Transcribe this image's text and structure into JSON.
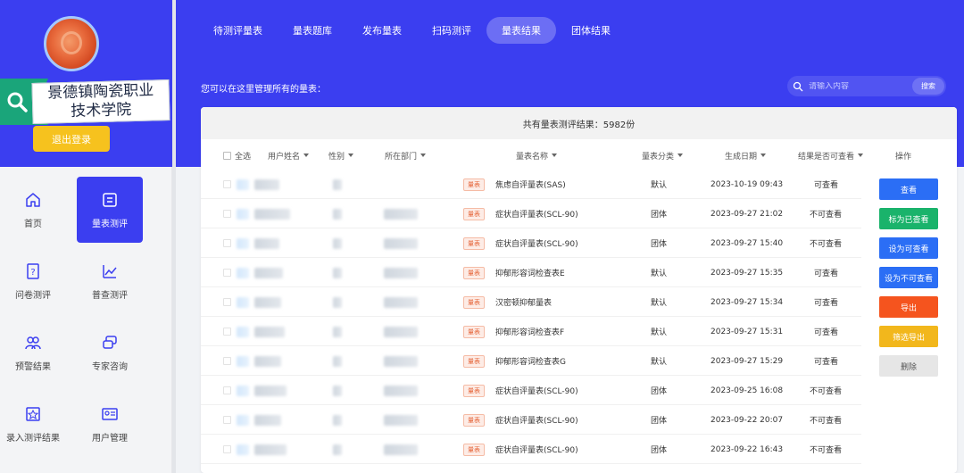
{
  "sidebar": {
    "school_name_line1": "景德镇陶瓷职业",
    "school_name_line2": "技术学院",
    "logout_label": "退出登录",
    "items": [
      {
        "label": "首页",
        "icon": "home-icon"
      },
      {
        "label": "量表测评",
        "icon": "scale-test-icon",
        "active": true
      },
      {
        "label": "问卷测评",
        "icon": "questionnaire-icon"
      },
      {
        "label": "普查测评",
        "icon": "census-chart-icon"
      },
      {
        "label": "预警结果",
        "icon": "warning-users-icon"
      },
      {
        "label": "专家咨询",
        "icon": "expert-chat-icon"
      },
      {
        "label": "录入测评结果",
        "icon": "entry-result-icon"
      },
      {
        "label": "用户管理",
        "icon": "user-card-icon"
      }
    ]
  },
  "tabs": [
    {
      "label": "待测评量表"
    },
    {
      "label": "量表题库"
    },
    {
      "label": "发布量表"
    },
    {
      "label": "扫码测评"
    },
    {
      "label": "量表结果",
      "active": true
    },
    {
      "label": "团体结果"
    }
  ],
  "hint": "您可以在这里管理所有的量表：",
  "search": {
    "placeholder": "请输入内容",
    "button": "搜索"
  },
  "summary": "共有量表测评结果：5982份",
  "columns": {
    "select_all": "全选",
    "name": "用户姓名",
    "gender": "性别",
    "dept": "所在部门",
    "scale_name": "量表名称",
    "category": "量表分类",
    "date": "生成日期",
    "visible": "结果是否可查看",
    "ops": "操作"
  },
  "tag_label": "量表",
  "rows": [
    {
      "scale": "焦虑自评量表(SAS)",
      "category": "默认",
      "date": "2023-10-19 09:43",
      "visible": "可查看"
    },
    {
      "scale": "症状自评量表(SCL-90)",
      "category": "团体",
      "date": "2023-09-27 21:02",
      "visible": "不可查看"
    },
    {
      "scale": "症状自评量表(SCL-90)",
      "category": "团体",
      "date": "2023-09-27 15:40",
      "visible": "不可查看"
    },
    {
      "scale": "抑郁形容词检查表E",
      "category": "默认",
      "date": "2023-09-27 15:35",
      "visible": "可查看"
    },
    {
      "scale": "汉密顿抑郁量表",
      "category": "默认",
      "date": "2023-09-27 15:34",
      "visible": "可查看"
    },
    {
      "scale": "抑郁形容词检查表F",
      "category": "默认",
      "date": "2023-09-27 15:31",
      "visible": "可查看"
    },
    {
      "scale": "抑郁形容词检查表G",
      "category": "默认",
      "date": "2023-09-27 15:29",
      "visible": "可查看"
    },
    {
      "scale": "症状自评量表(SCL-90)",
      "category": "团体",
      "date": "2023-09-25 16:08",
      "visible": "不可查看"
    },
    {
      "scale": "症状自评量表(SCL-90)",
      "category": "团体",
      "date": "2023-09-22 20:07",
      "visible": "不可查看"
    },
    {
      "scale": "症状自评量表(SCL-90)",
      "category": "团体",
      "date": "2023-09-22 16:43",
      "visible": "不可查看"
    }
  ],
  "actions": [
    {
      "label": "查看",
      "color": "#2b6ef5"
    },
    {
      "label": "标为已查看",
      "color": "#1ab36b"
    },
    {
      "label": "设为可查看",
      "color": "#2b6ef5"
    },
    {
      "label": "设为不可查看",
      "color": "#2b6ef5"
    },
    {
      "label": "导出",
      "color": "#f5541e"
    },
    {
      "label": "筛选导出",
      "color": "#f2b71c"
    },
    {
      "label": "删除",
      "color": "#e6e6e6"
    }
  ],
  "colors": {
    "primary": "#3b3ef0",
    "accent_yellow": "#f6c21e",
    "banner_green": "#1aa57a"
  }
}
